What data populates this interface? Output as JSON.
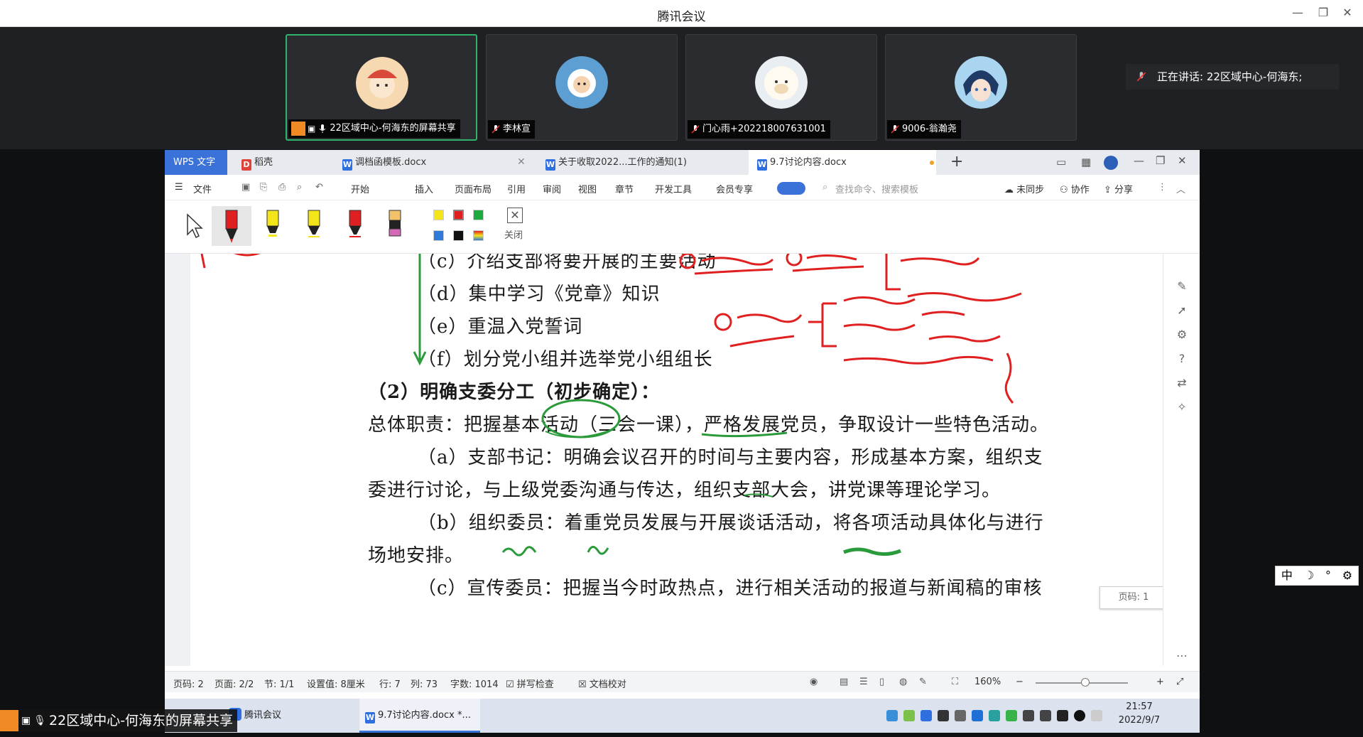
{
  "window": {
    "title": "腾讯会议"
  },
  "participants": [
    {
      "name": "22区域中心-何海东的屏幕共享"
    },
    {
      "name": "李林宣"
    },
    {
      "name": "门心雨+202218007631001"
    },
    {
      "name": "9006-翁瀚尧"
    }
  ],
  "speaking": "正在讲话: 22区域中心-何海东;",
  "wps": {
    "app_tab": "WPS 文字",
    "tabs": [
      "稻壳",
      "调档函模板.docx",
      "关于收取2022...工作的通知(1)",
      "9.7讨论内容.docx"
    ],
    "menu": [
      "文件",
      "开始",
      "插入",
      "页面布局",
      "引用",
      "审阅",
      "视图",
      "章节",
      "开发工具",
      "会员专享"
    ],
    "search_placeholder": "查找命令、搜索模板",
    "right_actions": [
      "未同步",
      "协作",
      "分享"
    ],
    "close_label": "关闭",
    "tooltip": "页码: 1"
  },
  "document": {
    "lines": [
      "（c）介绍支部将要开展的主要活动",
      "（d）集中学习《党章》知识",
      "（e）重温入党誓词",
      "（f）划分党小组并选举党小组组长",
      "（2）明确支委分工（初步确定）：",
      "总体职责：把握基本活动（三会一课），严格发展党员，争取设计一些特色活动。",
      "（a）支部书记：明确会议召开的时间与主要内容，形成基本方案，组织支",
      "委进行讨论，与上级党委沟通与传达，组织支部大会，讲党课等理论学习。",
      "（b）组织委员：着重党员发展与开展谈话活动，将各项活动具体化与进行",
      "场地安排。",
      "（c）宣传委员：把握当今时政热点，进行相关活动的报道与新闻稿的审核"
    ]
  },
  "statusbar": {
    "page": "页码: 2",
    "pages": "页面: 2/2",
    "section": "节: 1/1",
    "setting": "设置值: 8厘米",
    "row": "行: 7",
    "col": "列: 73",
    "words": "字数: 1014",
    "spell": "拼写检查",
    "proof": "文档校对",
    "zoom": "160%"
  },
  "taskbar": {
    "items": [
      "腾讯会议",
      "9.7讨论内容.docx *..."
    ],
    "time": "21:57",
    "date": "2022/9/7"
  },
  "banner": "22区域中心-何海东的屏幕共享",
  "ime": [
    "中",
    "☽",
    "°",
    "⚙"
  ]
}
